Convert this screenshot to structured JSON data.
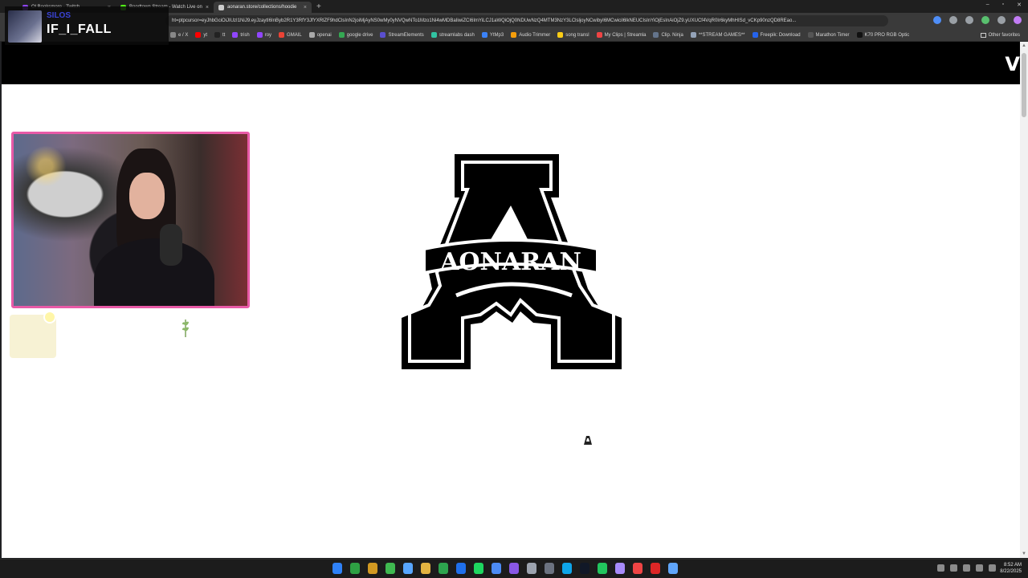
{
  "browser": {
    "tabs": [
      {
        "label": "Ol Booksmore - Twitch",
        "active": false,
        "color": "#9146ff"
      },
      {
        "label": "Boodtown Stream - Watch Live on",
        "active": false,
        "color": "#53fc18"
      },
      {
        "label": "aonaran.store/collections/hoodie",
        "active": true,
        "color": "#cccccc"
      }
    ],
    "address": "ht=ptpcursor=eyJhbGciOiJIUzI1NiJ9.eyJzaytI6InByb2R1Y3RfY3JfYXRlZF9hdClsInN2joiMjAyNS0wMy0yNVQwNTo1Mzo1Ni4wMDBaIiwiZCI6ImYiLCJ1aWQiOjQ0NDUwNzQ4MTM3NzY3LClsljoyNCwibyI6MCwicil6lkNEUCIsInYiOjEsInAiOjZ9.yUXUCf4VqR0Ir6kyMhHISd_vCKp90nzQD8REao...",
    "bookmarks": [
      {
        "label": "e / X",
        "color": "#888888"
      },
      {
        "label": "yt",
        "color": "#ff0000"
      },
      {
        "label": "tt",
        "color": "#222222"
      },
      {
        "label": "trish",
        "color": "#9146ff"
      },
      {
        "label": "roy",
        "color": "#9146ff"
      },
      {
        "label": "GMAIL",
        "color": "#ea4335"
      },
      {
        "label": "openai",
        "color": "#aaaaaa"
      },
      {
        "label": "google drive",
        "color": "#34a853"
      },
      {
        "label": "StreamElements",
        "color": "#5a4fcf"
      },
      {
        "label": "streamlabs dash",
        "color": "#31c3a2"
      },
      {
        "label": "YtMp3",
        "color": "#3b82f6"
      },
      {
        "label": "Audio Trimmer",
        "color": "#f59e0b"
      },
      {
        "label": "song transl",
        "color": "#facc15"
      },
      {
        "label": "My Clips | Streamla",
        "color": "#ef4444"
      },
      {
        "label": "Clip. Ninja",
        "color": "#64748b"
      },
      {
        "label": "**STREAM GAMES**",
        "color": "#94a3b8"
      },
      {
        "label": "Freepik: Download",
        "color": "#2563eb"
      },
      {
        "label": "Marathon Timer",
        "color": "#555555"
      },
      {
        "label": "K70 PRO RGB Optic",
        "color": "#111111"
      }
    ],
    "other_favorites": "Other favorites",
    "window_controls": [
      "–",
      "▫",
      "✕"
    ]
  },
  "site": {
    "header_letter": "V",
    "logo_text": "AONARAN"
  },
  "overlay": {
    "label": "SILOS",
    "now_playing": "IF_I_FALL"
  },
  "taskbar": {
    "apps": [
      "#2f81f7",
      "#2ea043",
      "#d29922",
      "#3fb950",
      "#58a6ff",
      "#e3b341",
      "#2da44e",
      "#1f6feb",
      "#1ed760",
      "#4c8bf5",
      "#8957e5",
      "#9ca3af",
      "#6b7280",
      "#0ea5e9",
      "#111827",
      "#22c55e",
      "#a78bfa",
      "#ef4444",
      "#dc2626",
      "#60a5fa"
    ],
    "time": "8:52 AM",
    "date": "8/22/2025"
  }
}
